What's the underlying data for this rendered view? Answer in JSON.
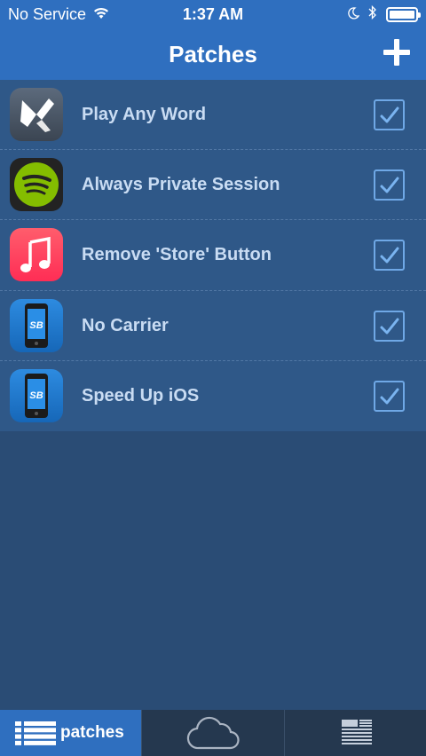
{
  "status_bar": {
    "carrier": "No Service",
    "time": "1:37 AM"
  },
  "nav": {
    "title": "Patches"
  },
  "patches": [
    {
      "label": "Play Any Word",
      "checked": true,
      "icon": "word-game-icon"
    },
    {
      "label": "Always Private Session",
      "checked": true,
      "icon": "spotify-icon"
    },
    {
      "label": "Remove 'Store' Button",
      "checked": true,
      "icon": "music-icon"
    },
    {
      "label": "No Carrier",
      "checked": true,
      "icon": "springboard-icon"
    },
    {
      "label": "Speed Up iOS",
      "checked": true,
      "icon": "springboard-icon"
    }
  ],
  "tabbar": {
    "patches_label": "patches"
  },
  "colors": {
    "navbar": "#2f6fbf",
    "list_bg": "#2f5888",
    "background": "#2a4c75",
    "tabbar": "#25384f"
  }
}
